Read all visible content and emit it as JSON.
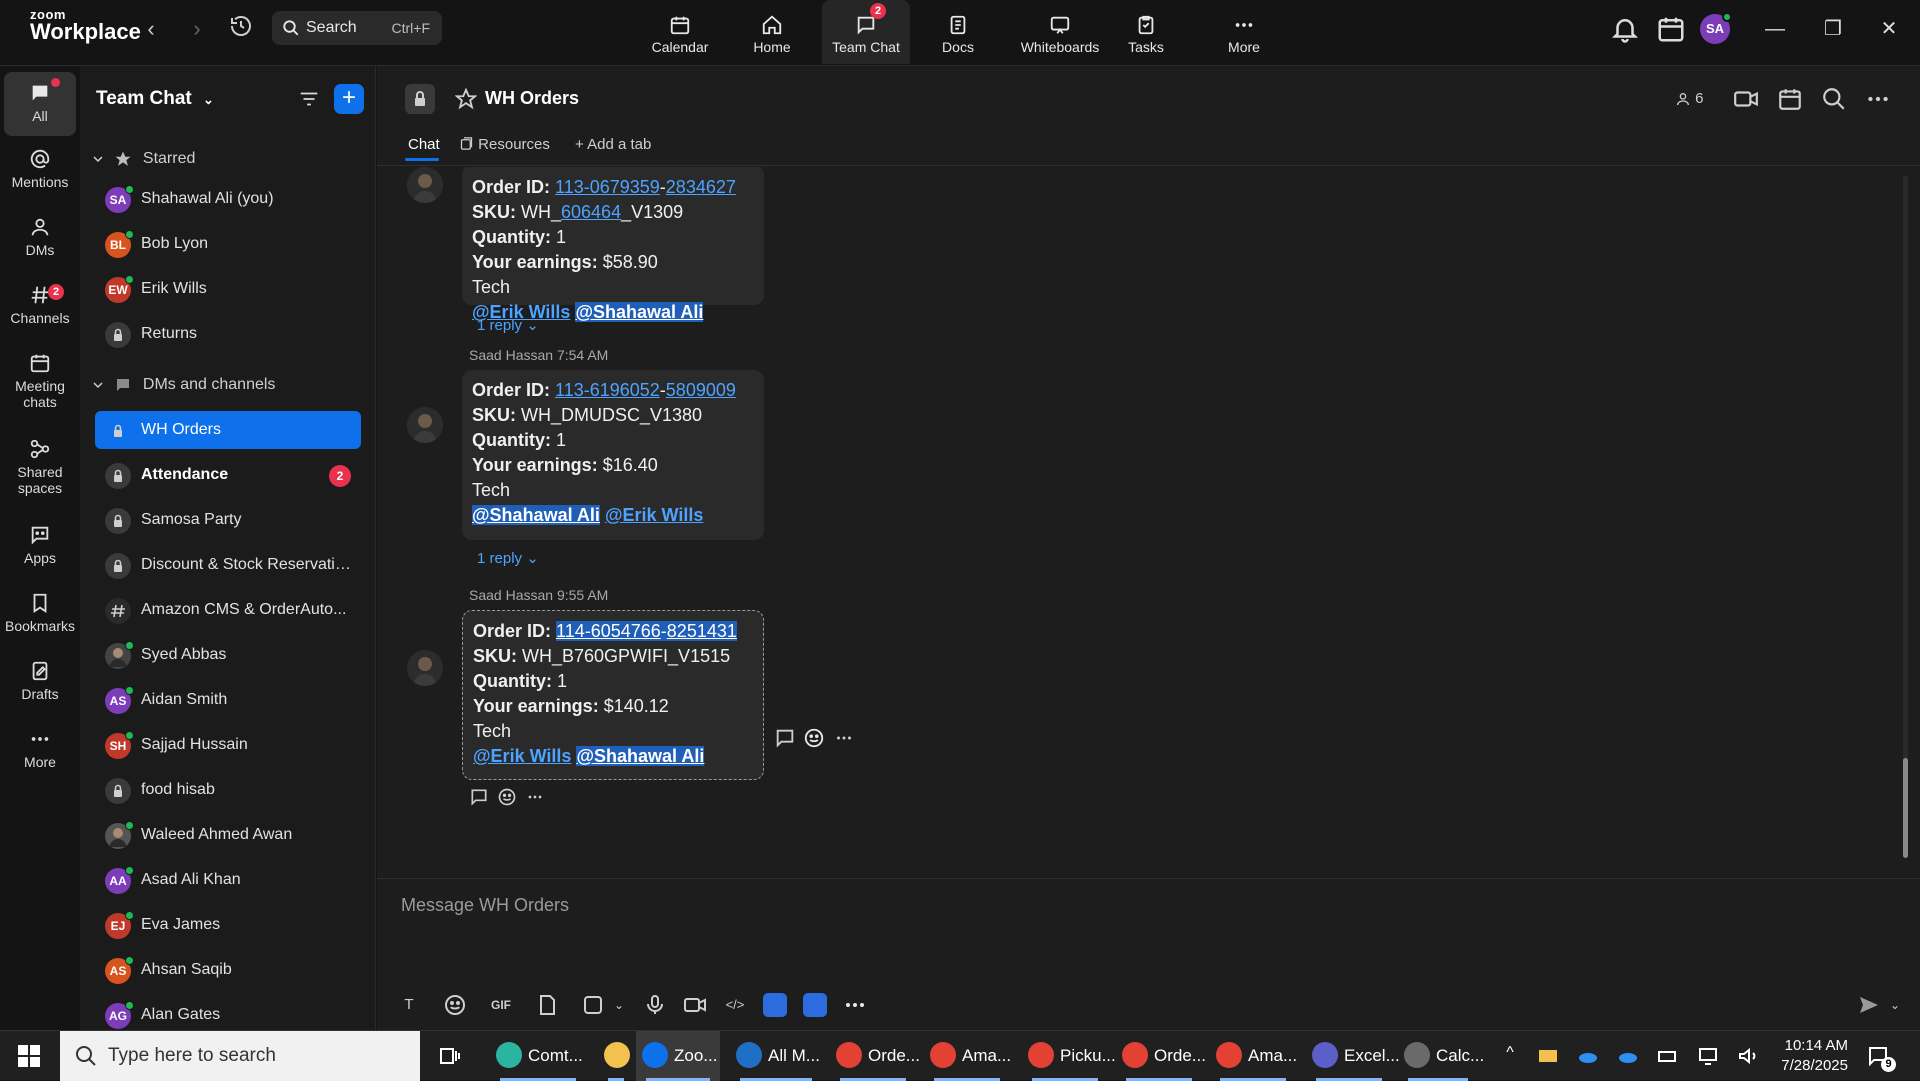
{
  "app": {
    "logo_line1": "zoom",
    "logo_line2": "Workplace",
    "search_label": "Search",
    "search_shortcut": "Ctrl+F",
    "tabs": [
      {
        "label": "Calendar",
        "icon": "calendar-icon"
      },
      {
        "label": "Home",
        "icon": "home-icon"
      },
      {
        "label": "Team Chat",
        "icon": "chat-icon",
        "badge": "2"
      },
      {
        "label": "Docs",
        "icon": "docs-icon"
      },
      {
        "label": "Whiteboards",
        "icon": "whiteboard-icon"
      },
      {
        "label": "Tasks",
        "icon": "tasks-icon"
      },
      {
        "label": "More",
        "icon": "more-icon"
      }
    ],
    "user_initials": "SA"
  },
  "rail": [
    {
      "label": "All",
      "icon": "chat-bubble-icon"
    },
    {
      "label": "Mentions",
      "icon": "at-icon"
    },
    {
      "label": "DMs",
      "icon": "people-icon"
    },
    {
      "label": "Channels",
      "icon": "hash-icon",
      "badge": "2"
    },
    {
      "label": "Meeting chats",
      "icon": "calendar-icon"
    },
    {
      "label": "Shared spaces",
      "icon": "share-icon"
    },
    {
      "label": "Apps",
      "icon": "apps-icon"
    },
    {
      "label": "Bookmarks",
      "icon": "bookmark-icon"
    },
    {
      "label": "Drafts",
      "icon": "drafts-icon"
    },
    {
      "label": "More",
      "icon": "more-icon"
    }
  ],
  "sidebar": {
    "title": "Team Chat",
    "starred_label": "Starred",
    "dms_label": "DMs and channels",
    "starred": [
      {
        "name": "Shahawal Ali (you)",
        "initials": "SA",
        "color": "#7d3cb8"
      },
      {
        "name": "Bob Lyon",
        "initials": "BL",
        "color": "#d9531e"
      },
      {
        "name": "Erik Wills",
        "initials": "EW",
        "color": "#c0392b"
      },
      {
        "name": "Returns",
        "type": "locked-channel"
      }
    ],
    "items": [
      {
        "name": "WH Orders",
        "type": "locked-channel"
      },
      {
        "name": "Attendance",
        "type": "locked-channel",
        "unread": "2"
      },
      {
        "name": "Samosa Party",
        "type": "locked-channel"
      },
      {
        "name": "Discount & Stock Reservatio...",
        "type": "locked-channel"
      },
      {
        "name": "Amazon CMS & OrderAuto...",
        "type": "hash-channel"
      },
      {
        "name": "Syed Abbas",
        "initials": "",
        "color": "#444444",
        "type": "photo"
      },
      {
        "name": "Aidan Smith",
        "initials": "AS",
        "color": "#7d3cb8"
      },
      {
        "name": "Sajjad Hussain",
        "initials": "SH",
        "color": "#c0392b"
      },
      {
        "name": "food hisab",
        "type": "locked-channel"
      },
      {
        "name": "Waleed Ahmed Awan",
        "initials": "",
        "color": "#555555",
        "type": "photo"
      },
      {
        "name": "Asad Ali Khan",
        "initials": "AA",
        "color": "#7d3cb8"
      },
      {
        "name": "Eva James",
        "initials": "EJ",
        "color": "#c0392b"
      },
      {
        "name": "Ahsan Saqib",
        "initials": "AS",
        "color": "#d9531e"
      },
      {
        "name": "Alan Gates",
        "initials": "AG",
        "color": "#7d3cb8"
      }
    ]
  },
  "channel": {
    "name": "WH Orders",
    "member_count": "6",
    "tabs": [
      "Chat",
      "Resources",
      "Add a tab"
    ]
  },
  "messages": [
    {
      "sender": "",
      "time": "",
      "order_label": "Order ID:",
      "order_p1": "113-0679359",
      "order_sep": "-",
      "order_p2": "2834627",
      "sku_label": "SKU:",
      "sku_pre": "WH_",
      "sku_link": "606464",
      "sku_post": "_V1309",
      "qty_label": "Quantity:",
      "qty": "1",
      "earn_label": "Your earnings:",
      "earn": "$58.90",
      "dept": "Tech",
      "mention1": "@Erik Wills",
      "mention2": "@Shahawal Ali",
      "reply": "1 reply"
    },
    {
      "sender": "Saad Hassan",
      "time": "7:54 AM",
      "order_label": "Order ID:",
      "order_p1": "113-6196052",
      "order_sep": "-",
      "order_p2": "5809009",
      "sku_label": "SKU:",
      "sku": "WH_DMUDSC_V1380",
      "qty_label": "Quantity:",
      "qty": "1",
      "earn_label": "Your earnings:",
      "earn": "$16.40",
      "dept": "Tech",
      "mention1": "@Shahawal Ali",
      "mention2": "@Erik Wills",
      "reply": "1 reply"
    },
    {
      "sender": "Saad Hassan",
      "time": "9:55 AM",
      "order_label": "Order ID:",
      "order_p1": "114-6054766",
      "order_sep": "-",
      "order_p2": "8251431",
      "sku_label": "SKU:",
      "sku": "WH_B760GPWIFI_V1515",
      "qty_label": "Quantity:",
      "qty": "1",
      "earn_label": "Your earnings:",
      "earn": "$140.12",
      "dept": "Tech",
      "mention1": "@Erik Wills",
      "mention2": "@Shahawal Ali"
    }
  ],
  "composer": {
    "placeholder": "Message WH Orders",
    "gif_label": "GIF"
  },
  "taskbar": {
    "search_placeholder": "Type here to search",
    "apps": [
      {
        "label": "Comt...",
        "color": "#2bb5a0"
      },
      {
        "label": "",
        "color": "#f2c14e"
      },
      {
        "label": "Zoo...",
        "color": "#0e71eb"
      },
      {
        "label": "All M...",
        "color": "#1f6fc5"
      },
      {
        "label": "Orde...",
        "color": "#e34133"
      },
      {
        "label": "Ama...",
        "color": "#e34133"
      },
      {
        "label": "Picku...",
        "color": "#e34133"
      },
      {
        "label": "Orde...",
        "color": "#e34133"
      },
      {
        "label": "Ama...",
        "color": "#e34133"
      },
      {
        "label": "Excel...",
        "color": "#5b5fc7"
      },
      {
        "label": "Calc...",
        "color": "#6a6a6a"
      }
    ],
    "time": "10:14 AM",
    "date": "7/28/2025",
    "notif_count": "9"
  }
}
